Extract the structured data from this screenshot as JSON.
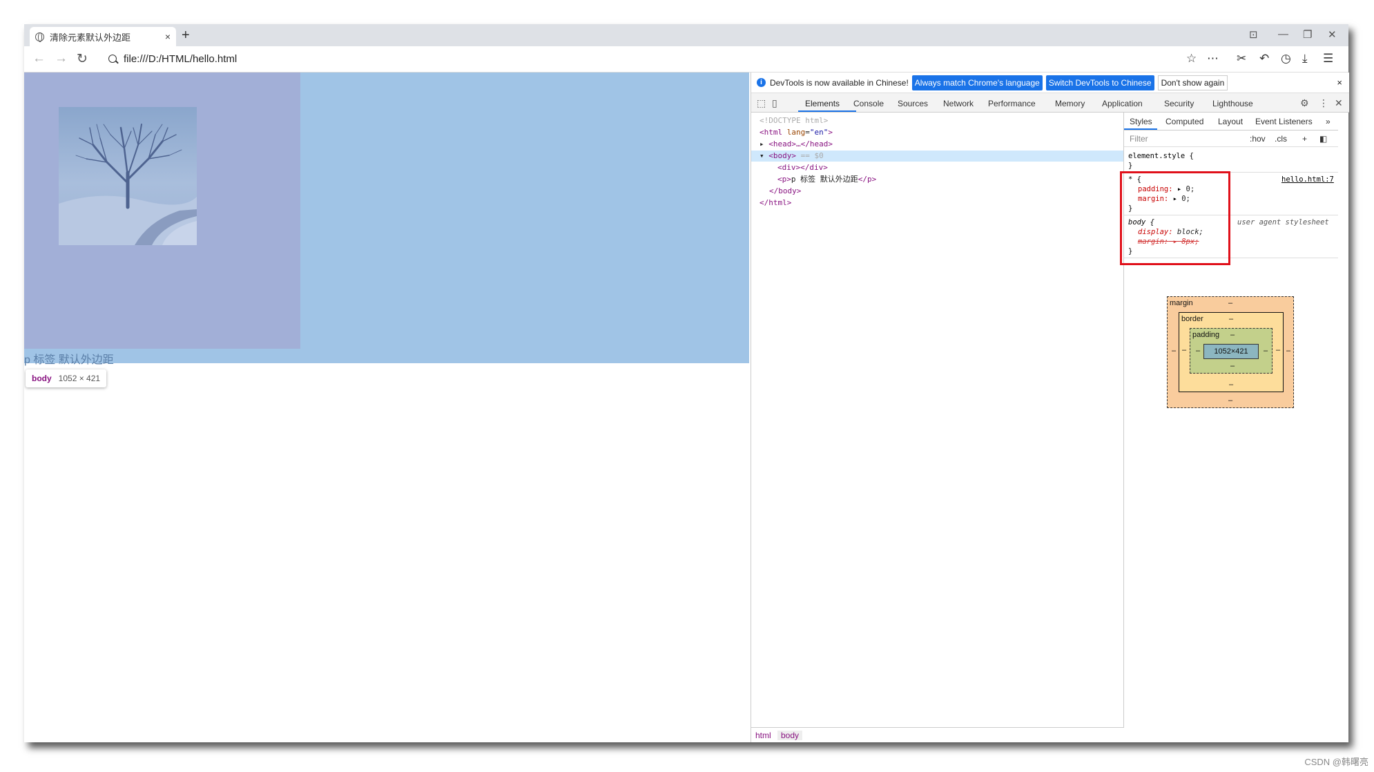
{
  "browser": {
    "tab_title": "清除元素默认外边距",
    "tab_close": "×",
    "new_tab": "+",
    "address": "file:///D:/HTML/hello.html"
  },
  "page": {
    "p_text": "p 标签 默认外边距",
    "tooltip_tag": "body",
    "tooltip_size": "1052 × 421"
  },
  "devtools": {
    "infobar": {
      "message": "DevTools is now available in Chinese!",
      "btn_match": "Always match Chrome's language",
      "btn_switch": "Switch DevTools to Chinese",
      "btn_dismiss": "Don't show again",
      "close": "×"
    },
    "tabs": [
      "Elements",
      "Console",
      "Sources",
      "Network",
      "Performance",
      "Memory",
      "Application",
      "Security",
      "Lighthouse"
    ],
    "elements": {
      "doctype": "<!DOCTYPE html>",
      "html_open": "<html",
      "html_attr": "lang",
      "html_attr_val": "\"en\"",
      "head": "<head>…</head>",
      "body_open": "<body>",
      "body_marker": "== $0",
      "div": "<div></div>",
      "p_open": "<p>",
      "p_text": "p 标签 默认外边距",
      "p_close": "</p>",
      "body_close": "</body>",
      "html_close": "</html>"
    },
    "breadcrumb": [
      "html",
      "body"
    ],
    "styles": {
      "tabs": [
        "Styles",
        "Computed",
        "Layout",
        "Event Listeners"
      ],
      "more": "»",
      "filter_placeholder": "Filter",
      "hov": ":hov",
      "cls": ".cls",
      "element_style": "element.style {",
      "close_brace": "}",
      "star_selector": "* {",
      "source_link": "hello.html:7",
      "padding_prop": "padding:",
      "padding_val": "0;",
      "margin_prop": "margin:",
      "margin_val": "0;",
      "body_selector": "body {",
      "ua_label": "user agent stylesheet",
      "display_prop": "display:",
      "display_val": "block;",
      "margin_ua_prop": "margin:",
      "margin_ua_val": "8px;"
    },
    "box_model": {
      "margin_label": "margin",
      "border_label": "border",
      "padding_label": "padding",
      "dash": "–",
      "content_size": "1052×421"
    }
  },
  "watermark": "CSDN @韩曙亮"
}
